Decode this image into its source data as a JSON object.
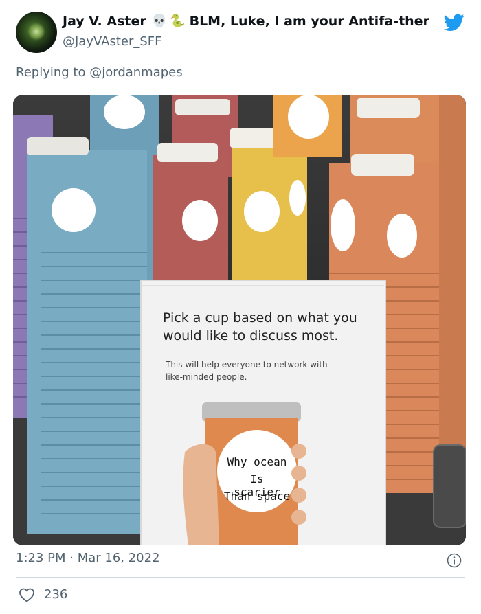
{
  "author": {
    "display_name": "Jay V. Aster",
    "emoji_1": "💀",
    "emoji_2": "🐍",
    "name_suffix": "BLM, Luke, I am your Antifa-ther",
    "handle": "@JayVAster_SFF"
  },
  "reply": {
    "prefix": "Replying to",
    "mention": "@jordanmapes"
  },
  "media": {
    "sign_title": "Pick a cup based on what you would like to discuss most.",
    "sign_subtitle_1": "This will help everyone to network with",
    "sign_subtitle_2": "like-minded people.",
    "cup_text_1": "Why ocean",
    "cup_text_2": "Is scarier",
    "cup_text_3": "Than space"
  },
  "meta": {
    "timestamp": "1:23 PM · Mar 16, 2022"
  },
  "stats": {
    "likes": "236"
  },
  "colors": {
    "twitter_blue": "#1d9bf0",
    "secondary_text": "#536471"
  },
  "icons": [
    "twitter-bird-icon",
    "info-icon",
    "heart-icon",
    "skull-icon",
    "snake-icon"
  ]
}
